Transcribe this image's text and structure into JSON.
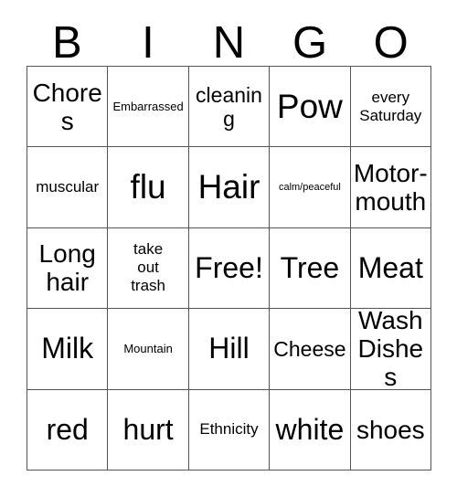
{
  "card": {
    "title_letters": [
      "B",
      "I",
      "N",
      "G",
      "O"
    ],
    "colors": {
      "background": "#ffffff",
      "text": "#000000",
      "grid_line": "#555555"
    },
    "rows": [
      [
        {
          "text": "Chores",
          "size": "md"
        },
        {
          "text": "Embarrassed",
          "size": "xxs"
        },
        {
          "text": "cleaning",
          "size": "sm"
        },
        {
          "text": "Pow",
          "size": "xl"
        },
        {
          "text": "every\nSaturday",
          "size": "xs"
        }
      ],
      [
        {
          "text": "muscular",
          "size": "xs"
        },
        {
          "text": "flu",
          "size": "xl"
        },
        {
          "text": "Hair",
          "size": "xl"
        },
        {
          "text": "calm/peaceful",
          "size": "tiny"
        },
        {
          "text": "Motor-\nmouth",
          "size": "md"
        }
      ],
      [
        {
          "text": "Long\nhair",
          "size": "md"
        },
        {
          "text": "take\nout\ntrash",
          "size": "xs"
        },
        {
          "text": "Free!",
          "size": "lg"
        },
        {
          "text": "Tree",
          "size": "lg"
        },
        {
          "text": "Meat",
          "size": "lg"
        }
      ],
      [
        {
          "text": "Milk",
          "size": "lg"
        },
        {
          "text": "Mountain",
          "size": "xxs"
        },
        {
          "text": "Hill",
          "size": "lg"
        },
        {
          "text": "Cheese",
          "size": "sm"
        },
        {
          "text": "Wash\nDishes",
          "size": "md"
        }
      ],
      [
        {
          "text": "red",
          "size": "lg"
        },
        {
          "text": "hurt",
          "size": "lg"
        },
        {
          "text": "Ethnicity",
          "size": "xs"
        },
        {
          "text": "white",
          "size": "lg"
        },
        {
          "text": "shoes",
          "size": "md"
        }
      ]
    ]
  }
}
